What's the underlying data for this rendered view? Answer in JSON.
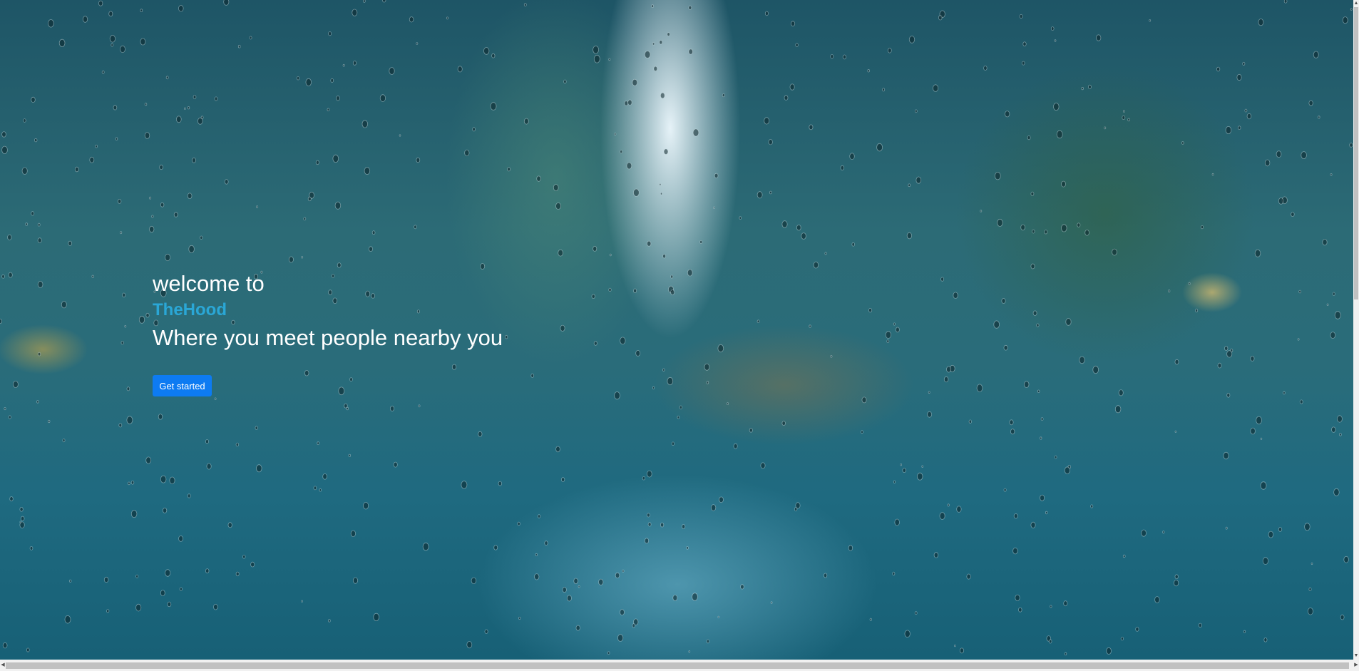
{
  "hero": {
    "welcome": "welcome to",
    "brand": "TheHood",
    "tagline": "Where you meet people nearby you",
    "cta_label": "Get started"
  },
  "colors": {
    "brand": "#2aa7d6",
    "button": "#0d7bf2",
    "text": "#ffffff"
  },
  "background": {
    "icon": "rain-window-city-photo"
  },
  "scrollbars": {
    "up_icon": "▲",
    "down_icon": "▼",
    "left_icon": "◀",
    "right_icon": "▶"
  }
}
